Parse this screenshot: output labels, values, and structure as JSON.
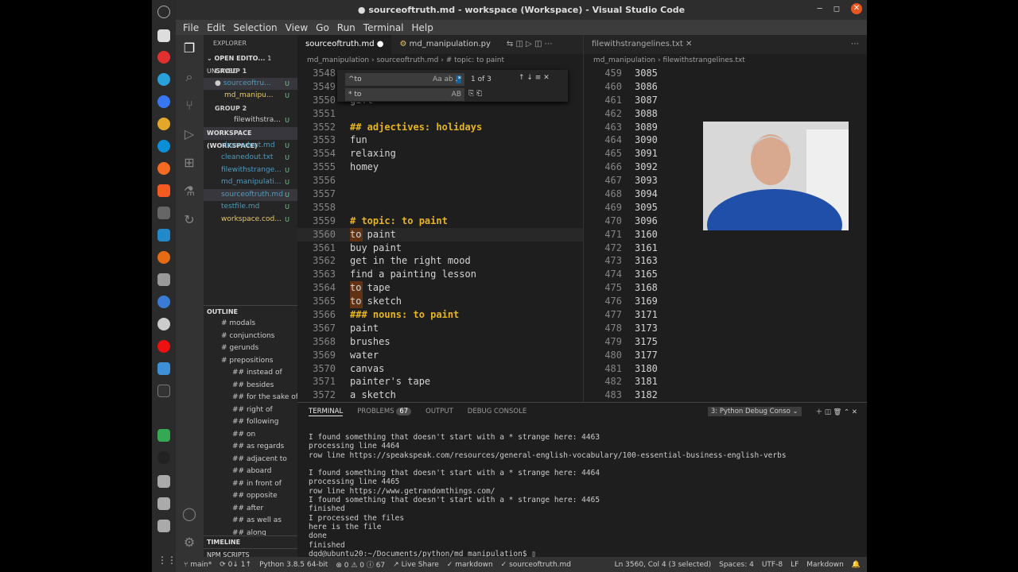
{
  "window": {
    "title": "● sourceoftruth.md - workspace (Workspace) - Visual Studio Code"
  },
  "menu": [
    "File",
    "Edit",
    "Selection",
    "View",
    "Go",
    "Run",
    "Terminal",
    "Help"
  ],
  "explorer": {
    "title": "EXPLORER",
    "open_editors": "OPEN EDITO...",
    "unsaved": "1 UNSAVED",
    "group1": "GROUP 1",
    "group1_items": [
      {
        "name": "sourceoftru...",
        "flag": "U"
      },
      {
        "name": "md_manipu...",
        "flag": "U"
      }
    ],
    "group2": "GROUP 2",
    "group2_items": [
      {
        "name": "filewithstra...",
        "flag": "U"
      }
    ],
    "workspace": "WORKSPACE (WORKSPACE)",
    "workspace_items": [
      {
        "name": "cleanedout.md",
        "flag": "U"
      },
      {
        "name": "cleanedout.txt",
        "flag": "U"
      },
      {
        "name": "filewithstrange...",
        "flag": "U"
      },
      {
        "name": "md_manipulati...",
        "flag": "U"
      },
      {
        "name": "sourceoftruth.md",
        "flag": "U"
      },
      {
        "name": "testfile.md",
        "flag": "U"
      },
      {
        "name": "workspace.cod...",
        "flag": "U"
      }
    ],
    "outline": "OUTLINE",
    "outline_items": [
      "# modals",
      "# conjunctions",
      "# gerunds",
      "# prepositions",
      "## instead of",
      "## besides",
      "## for the sake of",
      "## right of",
      "## following",
      "## on",
      "## as regards",
      "## adjacent to",
      "## aboard",
      "## in front of",
      "## opposite",
      "## after",
      "## as well as",
      "## along"
    ],
    "timeline": "TIMELINE",
    "npm": "NPM SCRIPTS"
  },
  "editor1": {
    "tabs": [
      {
        "label": "sourceoftruth.md ●"
      },
      {
        "label": "md_manipulation.py"
      }
    ],
    "breadcrumb": "md_manipulation › sourceoftruth.md › # topic: to paint",
    "find": {
      "query": "^to",
      "match": "1 of 3",
      "replace": "* to",
      "opt_case": "Aa",
      "opt_word": "ab",
      "opt_regex": ".*",
      "opt_preserve": "AB"
    },
    "lines": [
      {
        "n": "3548",
        "t": "",
        "h": false
      },
      {
        "n": "3549",
        "t": "",
        "h": false
      },
      {
        "n": "3550",
        "t": "gift",
        "h": false
      },
      {
        "n": "3551",
        "t": "",
        "h": false
      },
      {
        "n": "3552",
        "t": "## adjectives: holidays",
        "h": true
      },
      {
        "n": "3553",
        "t": "fun",
        "h": false
      },
      {
        "n": "3554",
        "t": "relaxing",
        "h": false
      },
      {
        "n": "3555",
        "t": "homey",
        "h": false
      },
      {
        "n": "3556",
        "t": "",
        "h": false
      },
      {
        "n": "3557",
        "t": "",
        "h": false
      },
      {
        "n": "3558",
        "t": "",
        "h": false
      },
      {
        "n": "3559",
        "t": "# topic: to paint",
        "h": true
      },
      {
        "n": "3560",
        "t": "to paint",
        "h": false,
        "m": true
      },
      {
        "n": "3561",
        "t": "buy paint",
        "h": false
      },
      {
        "n": "3562",
        "t": "get in the right mood",
        "h": false
      },
      {
        "n": "3563",
        "t": "find a painting lesson",
        "h": false
      },
      {
        "n": "3564",
        "t": "to tape",
        "h": false,
        "m": true
      },
      {
        "n": "3565",
        "t": "to sketch",
        "h": false,
        "m": true
      },
      {
        "n": "3566",
        "t": "### nouns: to paint",
        "h": true
      },
      {
        "n": "3567",
        "t": "paint",
        "h": false
      },
      {
        "n": "3568",
        "t": "brushes",
        "h": false
      },
      {
        "n": "3569",
        "t": "water",
        "h": false
      },
      {
        "n": "3570",
        "t": "canvas",
        "h": false
      },
      {
        "n": "3571",
        "t": "painter's tape",
        "h": false
      },
      {
        "n": "3572",
        "t": "a sketch",
        "h": false
      }
    ]
  },
  "editor2": {
    "tab": "filewithstrangelines.txt",
    "breadcrumb": "md_manipulation › filewithstrangelines.txt",
    "lines": [
      {
        "n": "459",
        "t": "3085"
      },
      {
        "n": "460",
        "t": "3086"
      },
      {
        "n": "461",
        "t": "3087"
      },
      {
        "n": "462",
        "t": "3088"
      },
      {
        "n": "463",
        "t": "3089"
      },
      {
        "n": "464",
        "t": "3090"
      },
      {
        "n": "465",
        "t": "3091"
      },
      {
        "n": "466",
        "t": "3092"
      },
      {
        "n": "467",
        "t": "3093"
      },
      {
        "n": "468",
        "t": "3094"
      },
      {
        "n": "469",
        "t": "3095"
      },
      {
        "n": "470",
        "t": "3096"
      },
      {
        "n": "471",
        "t": "3160"
      },
      {
        "n": "472",
        "t": "3161"
      },
      {
        "n": "473",
        "t": "3163"
      },
      {
        "n": "474",
        "t": "3165"
      },
      {
        "n": "475",
        "t": "3168"
      },
      {
        "n": "476",
        "t": "3169"
      },
      {
        "n": "477",
        "t": "3171"
      },
      {
        "n": "478",
        "t": "3173"
      },
      {
        "n": "479",
        "t": "3175"
      },
      {
        "n": "480",
        "t": "3177"
      },
      {
        "n": "481",
        "t": "3180"
      },
      {
        "n": "482",
        "t": "3181"
      },
      {
        "n": "483",
        "t": "3182"
      }
    ]
  },
  "panel": {
    "tabs": [
      "TERMINAL",
      "PROBLEMS",
      "OUTPUT",
      "DEBUG CONSOLE"
    ],
    "problems_count": "67",
    "terminal_select": "3: Python Debug Conso",
    "lines": [
      "I found something that doesn't start with a * strange here: 4463",
      "processing line 4464",
      "row line https://speakspeak.com/resources/general-english-vocabulary/100-essential-business-english-verbs",
      "",
      "I found something that doesn't start with a * strange here: 4464",
      "processing line 4465",
      "row line https://www.getrandomthings.com/",
      "I found something that doesn't start with a * strange here: 4465",
      "finished",
      "I processed the files",
      "here is the file",
      "done",
      "finished",
      "dgd@ubuntu20:~/Documents/python/md_manipulation$ ▯"
    ]
  },
  "status": {
    "branch": "main*",
    "sync": "⟳ 0↓ 1↑",
    "python": "Python 3.8.5 64-bit",
    "errors": "⊗ 0 ⚠ 0 ⓘ 67",
    "liveshare": "Live Share",
    "lang1": "markdown",
    "file": "sourceoftruth.md",
    "position": "Ln 3560, Col 4 (3 selected)",
    "spaces": "Spaces: 4",
    "encoding": "UTF-8",
    "eol": "LF",
    "language": "Markdown"
  }
}
